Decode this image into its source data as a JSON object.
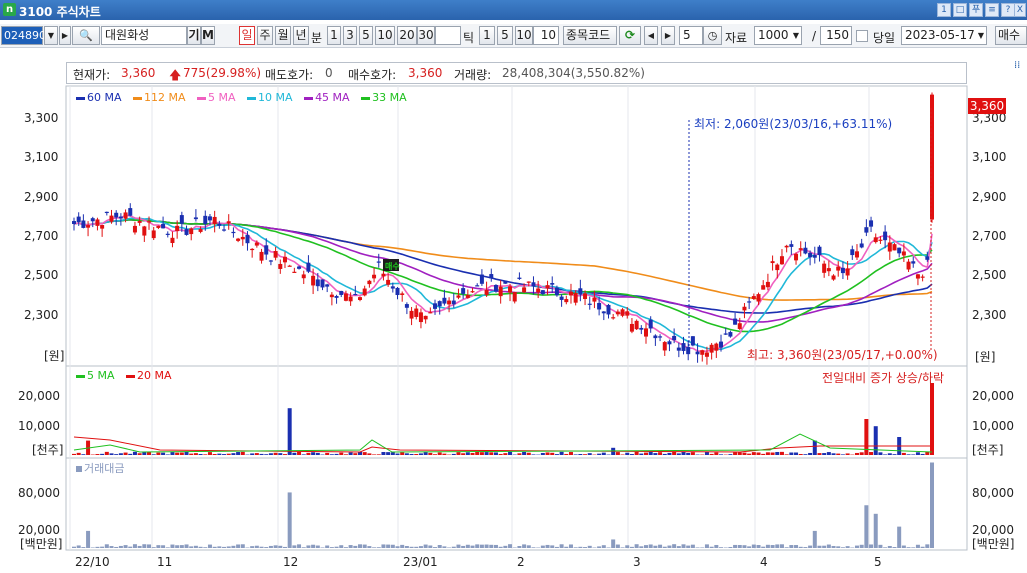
{
  "window": {
    "app_number": "3100",
    "title": "주식차트",
    "buttons": [
      "1",
      "□",
      "푸",
      "≡",
      "?",
      "X"
    ]
  },
  "toolbar": {
    "stock_code": "024890",
    "stock_name": "대원화성",
    "btn_gi": "기",
    "btn_m": "M",
    "periods": [
      "일",
      "주",
      "월",
      "년",
      "분"
    ],
    "selected_period": "일",
    "minute_options": [
      "1",
      "3",
      "5",
      "10",
      "20",
      "30"
    ],
    "tick_value": "",
    "tick_label": "틱",
    "tick_options": [
      "1",
      "5",
      "10"
    ],
    "tick_input": "10",
    "code_label": "종목코드",
    "step_value": "5",
    "data_label": "자료",
    "data_count": "1000",
    "slash": "/",
    "data_total": "150",
    "today_label": "당일",
    "date": "2023-05-17",
    "buy_label": "매수"
  },
  "info": {
    "current_label": "현재가:",
    "current_price": "3,360",
    "change": "775(29.98%)",
    "ask_label": "매도호가:",
    "ask_value": "0",
    "bid_label": "매수호가:",
    "bid_value": "3,360",
    "volume_label": "거래량:",
    "volume_value": "28,408,304(3,550.82%)"
  },
  "price_legend": [
    {
      "name": "60 MA",
      "color": "#1a2fb0"
    },
    {
      "name": "112 MA",
      "color": "#f08c1a"
    },
    {
      "name": "5 MA",
      "color": "#f060c0"
    },
    {
      "name": "10 MA",
      "color": "#20b8d8"
    },
    {
      "name": "45 MA",
      "color": "#a020c0"
    },
    {
      "name": "33 MA",
      "color": "#20c020"
    }
  ],
  "price_axis": [
    "3,300",
    "3,100",
    "2,900",
    "2,700",
    "2,500",
    "2,300"
  ],
  "price_unit": "[원]",
  "current_badge": "3,360",
  "annotations": {
    "low": "최저: 2,060원(23/03/16,+63.11%)",
    "high": "최고: 3,360원(23/05/17,+0.00%)",
    "volume_note": "전일대비 증가 상승/하락"
  },
  "volume_legend": [
    {
      "name": "5 MA",
      "color": "#20c020"
    },
    {
      "name": "20 MA",
      "color": "#e01010"
    }
  ],
  "volume_axis": [
    "20,000",
    "10,000"
  ],
  "volume_unit": "[천주]",
  "amount_legend": "거래대금",
  "amount_axis": [
    "80,000",
    "20,000"
  ],
  "amount_unit": "[백만원]",
  "x_labels": [
    "22/10",
    "11",
    "12",
    "23/01",
    "2",
    "3",
    "4",
    "5"
  ],
  "colors": {
    "up": "#e01010",
    "down": "#1a2fb0",
    "title_bar": "#2a63ad"
  },
  "chart_data": {
    "type": "candlestick",
    "period": "daily",
    "start": "2022-10",
    "end": "2023-05-17",
    "price_range": [
      2100,
      3400
    ],
    "last_close": 3360,
    "last_change_pct": 29.98,
    "moving_averages": [
      5,
      10,
      33,
      45,
      60,
      112
    ],
    "volume_last_thousand": 28408
  }
}
